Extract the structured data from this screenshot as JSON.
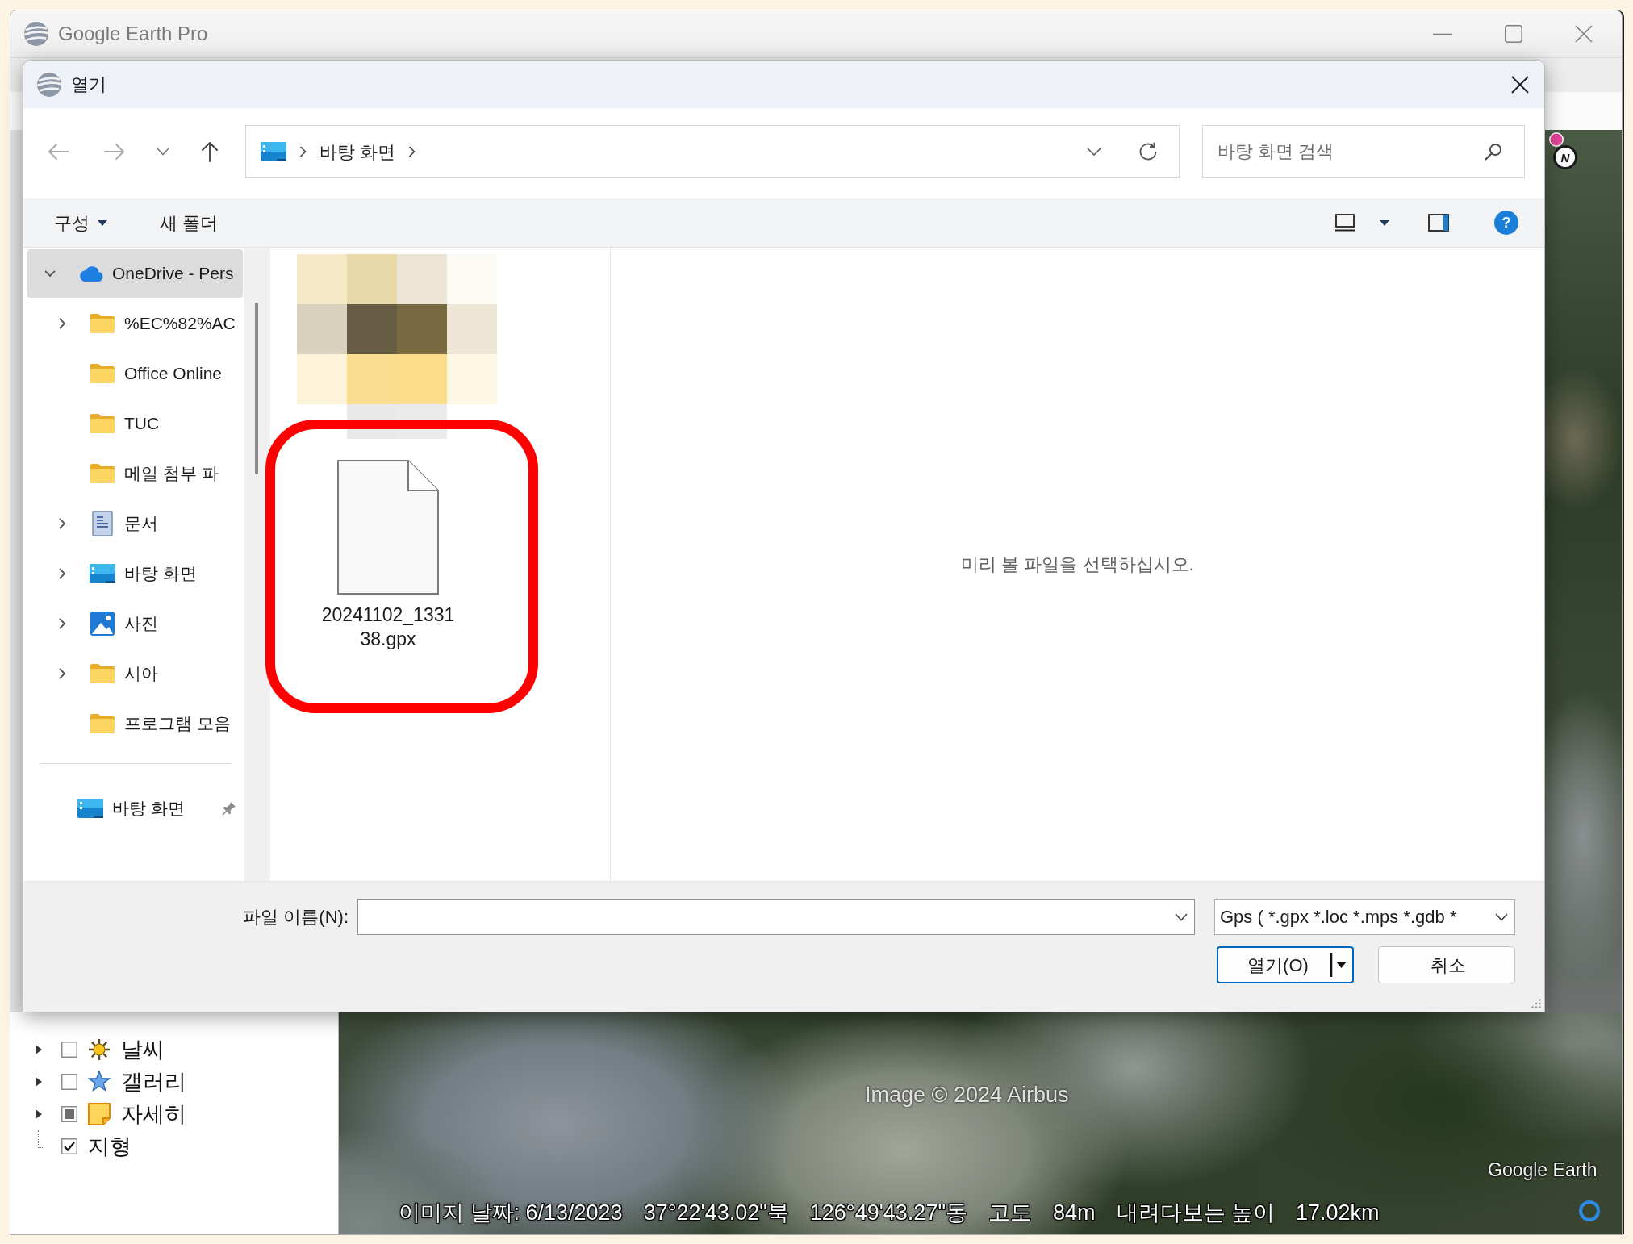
{
  "app_window": {
    "title": "Google Earth Pro"
  },
  "open_dialog": {
    "title": "열기",
    "nav_buttons": [
      {
        "kind": "back",
        "disabled": true
      },
      {
        "kind": "forward",
        "disabled": true
      },
      {
        "kind": "recent",
        "disabled": false
      },
      {
        "kind": "up",
        "disabled": false
      }
    ],
    "address": {
      "segments": [
        "바탕 화면"
      ]
    },
    "search": {
      "placeholder": "바탕 화면 검색"
    },
    "commands": [
      {
        "label": "구성",
        "dropdown": true
      },
      {
        "label": "새 폴더",
        "dropdown": false
      }
    ],
    "help": "?",
    "nav_tree": [
      {
        "label": "OneDrive - Pers",
        "kind": "cloud",
        "selected": true,
        "expanded": true,
        "children": [
          {
            "label": "%EC%82%AC",
            "kind": "folder",
            "selected": false,
            "expanded": false
          },
          {
            "label": "Office Online",
            "kind": "folder",
            "selected": false
          },
          {
            "label": "TUC",
            "kind": "folder",
            "selected": false
          },
          {
            "label": "메일 첨부 파",
            "kind": "folder",
            "selected": false
          },
          {
            "label": "문서",
            "kind": "documents",
            "selected": false,
            "expanded": false
          },
          {
            "label": "바탕 화면",
            "kind": "desktop",
            "selected": false,
            "expanded": false
          },
          {
            "label": "사진",
            "kind": "pictures",
            "selected": false,
            "expanded": false
          },
          {
            "label": "시아",
            "kind": "folder",
            "selected": false,
            "expanded": false
          },
          {
            "label": "프로그램 모음",
            "kind": "folder",
            "selected": false
          }
        ]
      }
    ],
    "quick_access": [
      {
        "label": "바탕 화면",
        "kind": "desktop",
        "pinned": true,
        "selected": false
      }
    ],
    "files": [
      {
        "kind": "blurred"
      },
      {
        "kind": "file",
        "name": "20241102_133138.gpx",
        "circled": true
      }
    ],
    "preview_message": "미리 볼 파일을 선택하십시오.",
    "file_name": {
      "label": "파일 이름(N):"
    },
    "file_type": {
      "value": "Gps ( *.gpx *.loc *.mps *.gdb *"
    },
    "buttons": [
      {
        "label": "열기(O)",
        "kind": "split",
        "default": true
      },
      {
        "label": "취소",
        "kind": "plain",
        "default": false
      }
    ]
  },
  "layers": [
    {
      "label": "날씨",
      "kind": "sun",
      "expandable": true,
      "checked": false,
      "partial": false
    },
    {
      "label": "갤러리",
      "kind": "star",
      "expandable": true,
      "checked": false,
      "partial": false
    },
    {
      "label": "자세히",
      "kind": "note",
      "expandable": true,
      "checked": false,
      "partial": true
    },
    {
      "label": "지형",
      "kind": "plain",
      "expandable": false,
      "checked": true,
      "partial": false
    }
  ],
  "map": {
    "compass": "N",
    "attribution": "Image © 2024 Airbus",
    "logo": "Google Earth",
    "status_bar": [
      "이미지 날짜: 6/13/2023",
      "37°22'43.02\"북",
      "126°49'43.27\"동",
      "고도",
      "84m",
      "내려다보는 높이",
      "17.02km"
    ]
  }
}
